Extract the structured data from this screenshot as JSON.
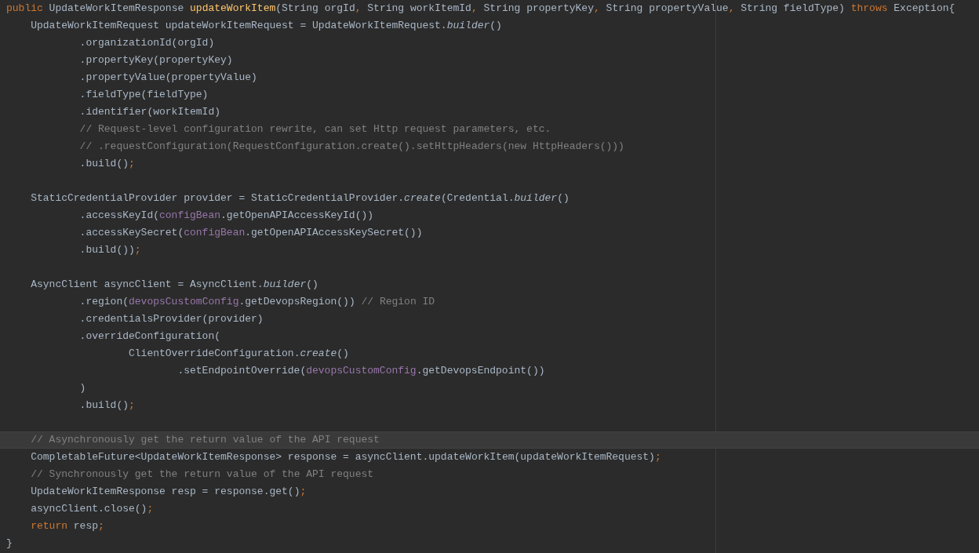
{
  "editor": {
    "lines": [
      {
        "kind": "code",
        "current": false,
        "tokens": [
          {
            "kind": "keyword",
            "text": "public"
          },
          {
            "kind": "plain",
            "text": " UpdateWorkItemResponse "
          },
          {
            "kind": "declaration",
            "text": "updateWorkItem"
          },
          {
            "kind": "plain",
            "text": "(String orgId"
          },
          {
            "kind": "keyword",
            "text": ","
          },
          {
            "kind": "plain",
            "text": " String workItemId"
          },
          {
            "kind": "keyword",
            "text": ","
          },
          {
            "kind": "plain",
            "text": " String propertyKey"
          },
          {
            "kind": "keyword",
            "text": ","
          },
          {
            "kind": "plain",
            "text": " String propertyValue"
          },
          {
            "kind": "keyword",
            "text": ","
          },
          {
            "kind": "plain",
            "text": " String fieldType) "
          },
          {
            "kind": "keyword",
            "text": "throws"
          },
          {
            "kind": "plain",
            "text": " Exception{"
          }
        ],
        "children": [
          {
            "kind": "code",
            "current": false,
            "tokens": [
              {
                "kind": "plain",
                "text": "UpdateWorkItemRequest updateWorkItemRequest = UpdateWorkItemRequest."
              },
              {
                "kind": "italic",
                "text": "builder"
              },
              {
                "kind": "plain",
                "text": "()"
              }
            ],
            "children": [
              {
                "kind": "code",
                "current": false,
                "tokens": [
                  {
                    "kind": "plain",
                    "text": ".organizationId(orgId)"
                  }
                ]
              },
              {
                "kind": "code",
                "current": false,
                "tokens": [
                  {
                    "kind": "plain",
                    "text": ".propertyKey(propertyKey)"
                  }
                ]
              },
              {
                "kind": "code",
                "current": false,
                "tokens": [
                  {
                    "kind": "plain",
                    "text": ".propertyValue(propertyValue)"
                  }
                ]
              },
              {
                "kind": "code",
                "current": false,
                "tokens": [
                  {
                    "kind": "plain",
                    "text": ".fieldType(fieldType)"
                  }
                ]
              },
              {
                "kind": "code",
                "current": false,
                "tokens": [
                  {
                    "kind": "plain",
                    "text": ".identifier(workItemId)"
                  }
                ]
              },
              {
                "kind": "code",
                "current": false,
                "tokens": [
                  {
                    "kind": "comment",
                    "text": "// Request-level configuration rewrite, can set Http request parameters, etc."
                  }
                ]
              },
              {
                "kind": "code",
                "current": false,
                "tokens": [
                  {
                    "kind": "comment",
                    "text": "// .requestConfiguration(RequestConfiguration.create().setHttpHeaders(new HttpHeaders()))"
                  }
                ]
              },
              {
                "kind": "code",
                "current": false,
                "tokens": [
                  {
                    "kind": "plain",
                    "text": ".build()"
                  },
                  {
                    "kind": "keyword",
                    "text": ";"
                  }
                ]
              }
            ]
          },
          {
            "kind": "blank",
            "current": false
          },
          {
            "kind": "code",
            "current": false,
            "tokens": [
              {
                "kind": "plain",
                "text": "StaticCredentialProvider provider = StaticCredentialProvider."
              },
              {
                "kind": "italic",
                "text": "create"
              },
              {
                "kind": "plain",
                "text": "(Credential."
              },
              {
                "kind": "italic",
                "text": "builder"
              },
              {
                "kind": "plain",
                "text": "()"
              }
            ],
            "children": [
              {
                "kind": "code",
                "current": false,
                "tokens": [
                  {
                    "kind": "plain",
                    "text": ".accessKeyId("
                  },
                  {
                    "kind": "field",
                    "text": "configBean"
                  },
                  {
                    "kind": "plain",
                    "text": ".getOpenAPIAccessKeyId())"
                  }
                ]
              },
              {
                "kind": "code",
                "current": false,
                "tokens": [
                  {
                    "kind": "plain",
                    "text": ".accessKeySecret("
                  },
                  {
                    "kind": "field",
                    "text": "configBean"
                  },
                  {
                    "kind": "plain",
                    "text": ".getOpenAPIAccessKeySecret())"
                  }
                ]
              },
              {
                "kind": "code",
                "current": false,
                "tokens": [
                  {
                    "kind": "plain",
                    "text": ".build())"
                  },
                  {
                    "kind": "keyword",
                    "text": ";"
                  }
                ]
              }
            ]
          },
          {
            "kind": "blank",
            "current": false
          },
          {
            "kind": "code",
            "current": false,
            "tokens": [
              {
                "kind": "plain",
                "text": "AsyncClient asyncClient = AsyncClient."
              },
              {
                "kind": "italic",
                "text": "builder"
              },
              {
                "kind": "plain",
                "text": "()"
              }
            ],
            "children": [
              {
                "kind": "code",
                "current": false,
                "tokens": [
                  {
                    "kind": "plain",
                    "text": ".region("
                  },
                  {
                    "kind": "field",
                    "text": "devopsCustomConfig"
                  },
                  {
                    "kind": "plain",
                    "text": ".getDevopsRegion()) "
                  },
                  {
                    "kind": "comment",
                    "text": "// Region ID"
                  }
                ]
              },
              {
                "kind": "code",
                "current": false,
                "tokens": [
                  {
                    "kind": "plain",
                    "text": ".credentialsProvider(provider)"
                  }
                ]
              },
              {
                "kind": "code",
                "current": false,
                "tokens": [
                  {
                    "kind": "plain",
                    "text": ".overrideConfiguration("
                  }
                ],
                "children": [
                  {
                    "kind": "code",
                    "current": false,
                    "tokens": [
                      {
                        "kind": "plain",
                        "text": "ClientOverrideConfiguration."
                      },
                      {
                        "kind": "italic",
                        "text": "create"
                      },
                      {
                        "kind": "plain",
                        "text": "()"
                      }
                    ],
                    "children": [
                      {
                        "kind": "code",
                        "current": false,
                        "tokens": [
                          {
                            "kind": "plain",
                            "text": ".setEndpointOverride("
                          },
                          {
                            "kind": "field",
                            "text": "devopsCustomConfig"
                          },
                          {
                            "kind": "plain",
                            "text": ".getDevopsEndpoint())"
                          }
                        ]
                      }
                    ]
                  }
                ]
              },
              {
                "kind": "code",
                "current": false,
                "tokens": [
                  {
                    "kind": "plain",
                    "text": ")"
                  }
                ]
              },
              {
                "kind": "code",
                "current": false,
                "tokens": [
                  {
                    "kind": "plain",
                    "text": ".build()"
                  },
                  {
                    "kind": "keyword",
                    "text": ";"
                  }
                ]
              }
            ]
          },
          {
            "kind": "blank",
            "current": false
          },
          {
            "kind": "code",
            "current": true,
            "tokens": [
              {
                "kind": "comment",
                "text": "// Asynchronously get the return value of the API request"
              }
            ]
          },
          {
            "kind": "code",
            "current": false,
            "tokens": [
              {
                "kind": "plain",
                "text": "CompletableFuture<UpdateWorkItemResponse> response = asyncClient.updateWorkItem(updateWorkItemRequest)"
              },
              {
                "kind": "keyword",
                "text": ";"
              }
            ]
          },
          {
            "kind": "code",
            "current": false,
            "tokens": [
              {
                "kind": "comment",
                "text": "// Synchronously get the return value of the API request"
              }
            ]
          },
          {
            "kind": "code",
            "current": false,
            "tokens": [
              {
                "kind": "plain",
                "text": "UpdateWorkItemResponse resp = response.get()"
              },
              {
                "kind": "keyword",
                "text": ";"
              }
            ]
          },
          {
            "kind": "code",
            "current": false,
            "tokens": [
              {
                "kind": "plain",
                "text": "asyncClient.close()"
              },
              {
                "kind": "keyword",
                "text": ";"
              }
            ]
          },
          {
            "kind": "code",
            "current": false,
            "tokens": [
              {
                "kind": "keyword",
                "text": "return"
              },
              {
                "kind": "plain",
                "text": " resp"
              },
              {
                "kind": "keyword",
                "text": ";"
              }
            ]
          }
        ]
      },
      {
        "kind": "code",
        "current": false,
        "tokens": [
          {
            "kind": "plain",
            "text": "}"
          }
        ]
      }
    ]
  }
}
